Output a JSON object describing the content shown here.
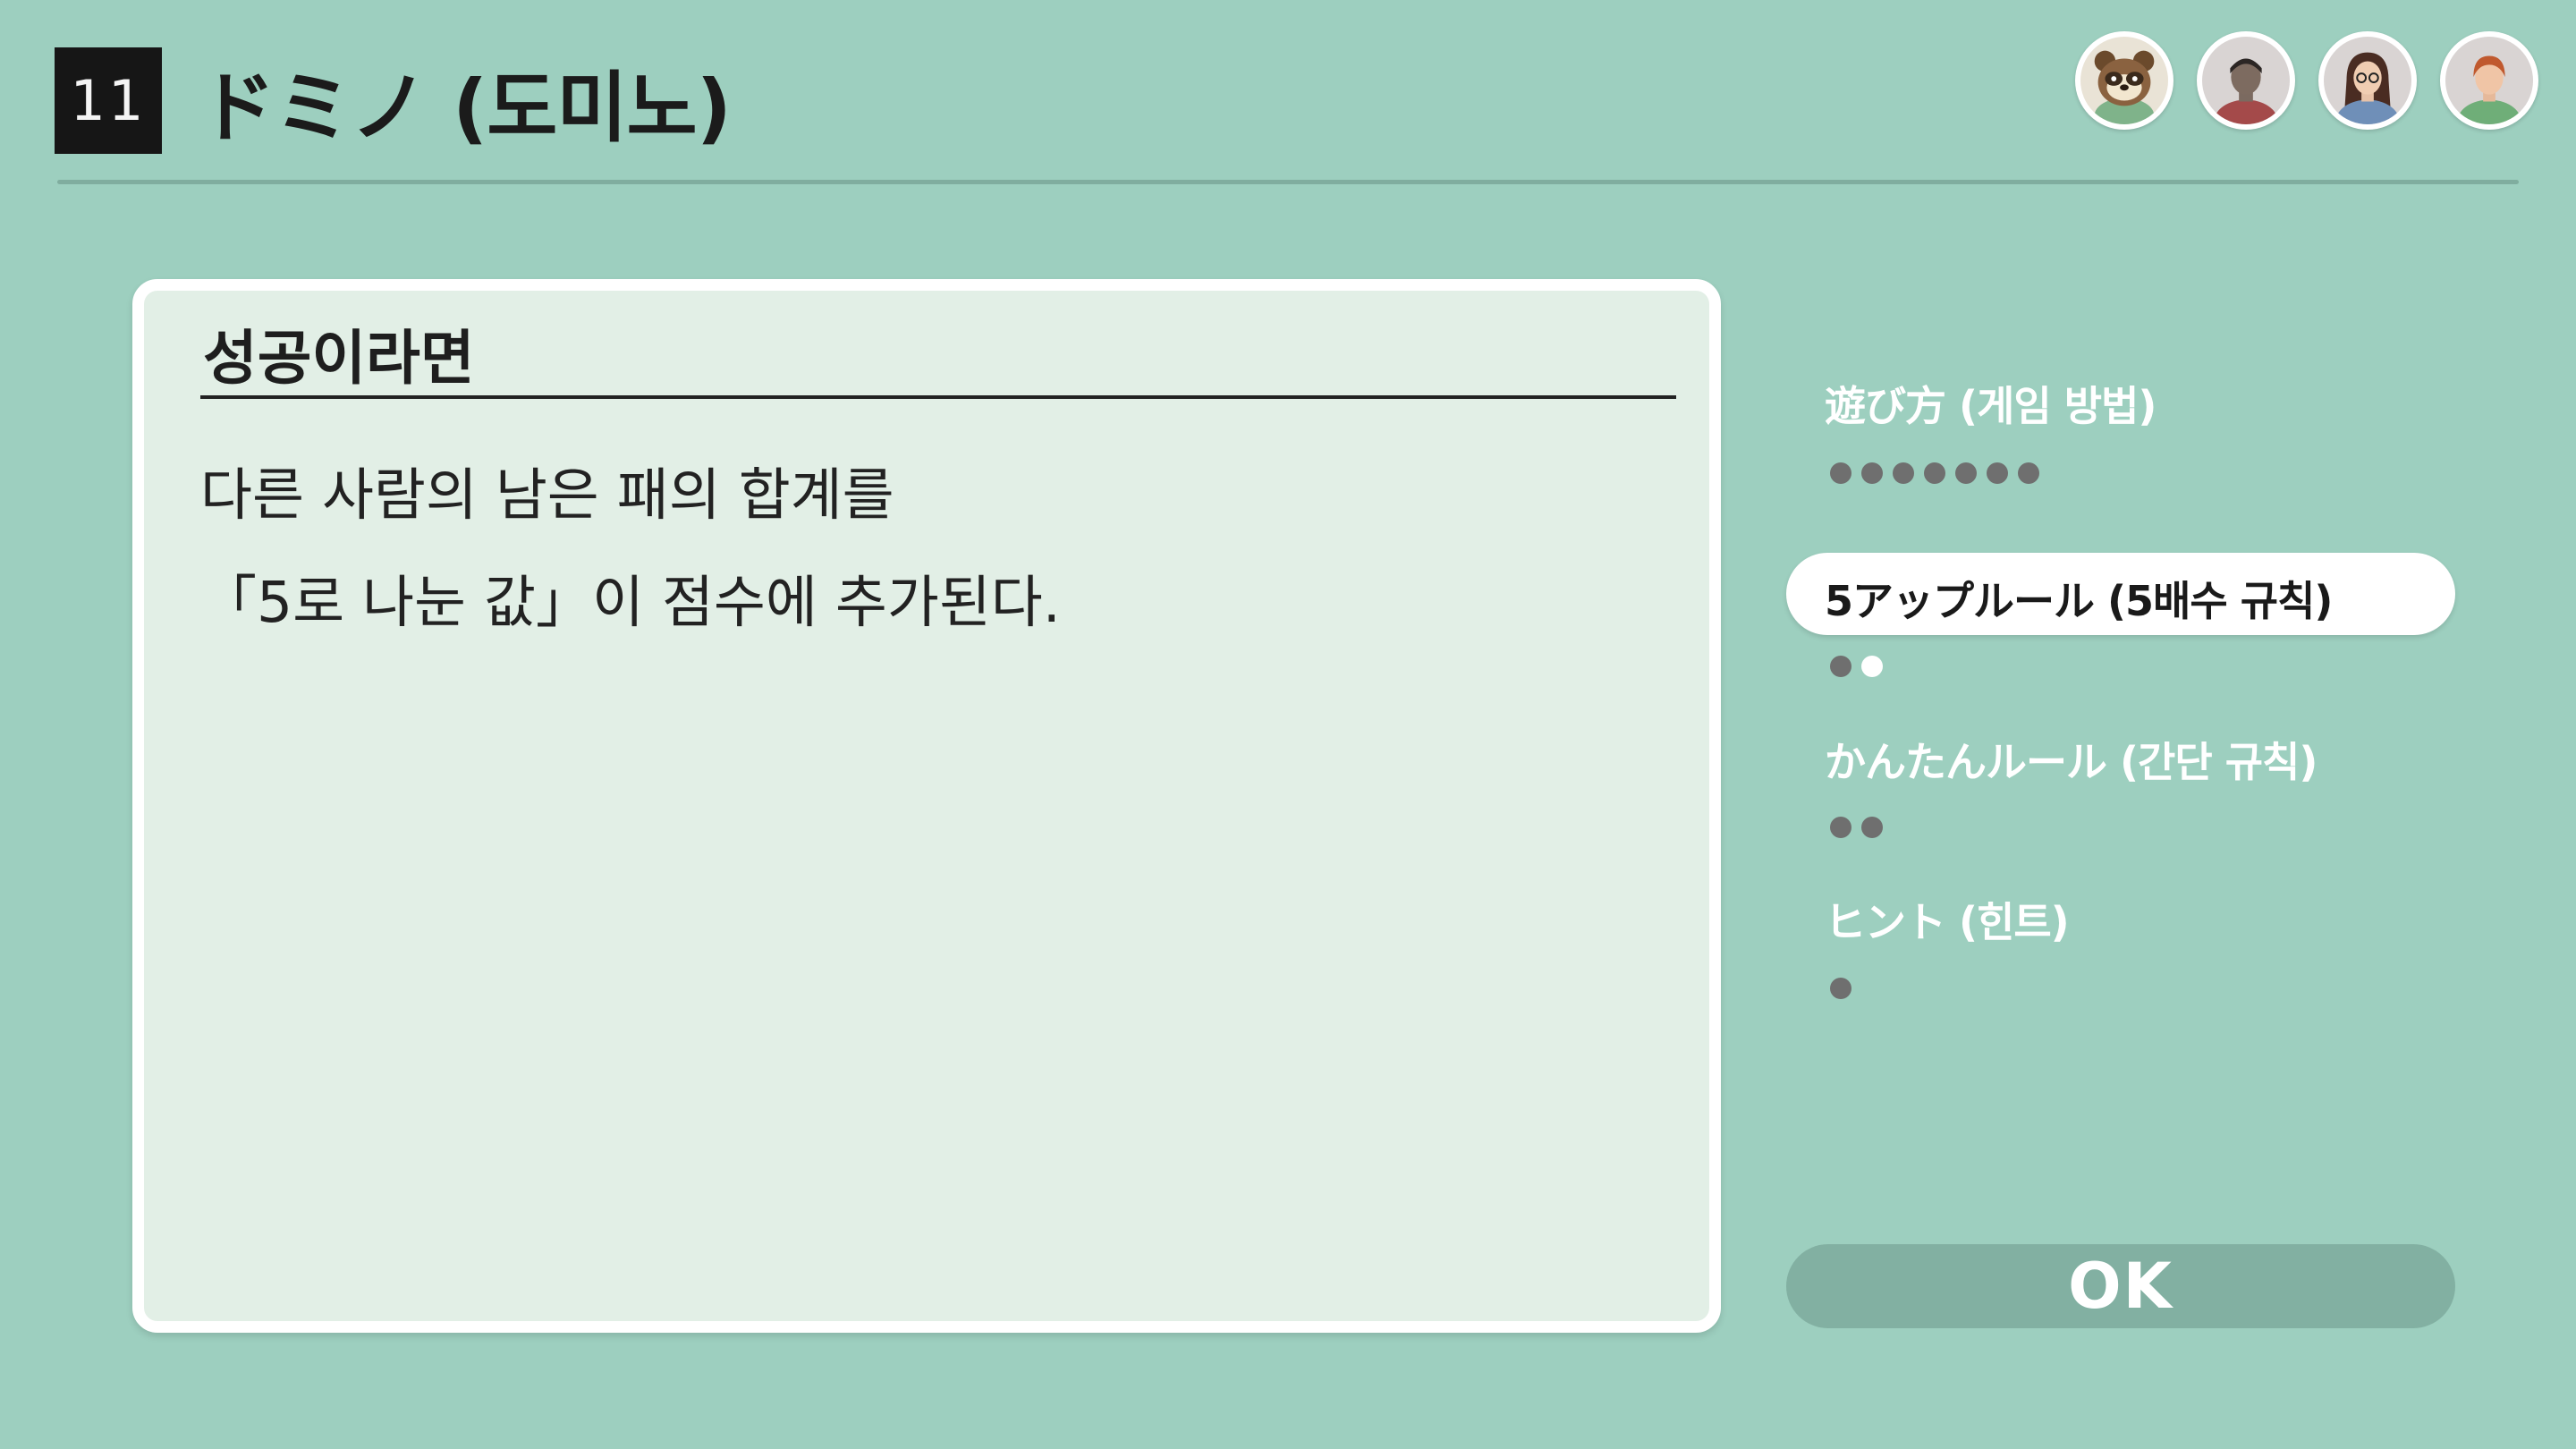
{
  "header": {
    "game_number": "11",
    "title": "ドミノ (도미노)"
  },
  "players": [
    {
      "icon": "raccoon-character-icon"
    },
    {
      "icon": "player-avatar-icon"
    },
    {
      "icon": "player-avatar-glasses-icon"
    },
    {
      "icon": "player-avatar-icon"
    }
  ],
  "card": {
    "heading": "성공이라면",
    "lines": [
      "다른 사람의 남은 패의 합계를",
      "「5로 나눈 값」이 점수에 추가된다."
    ]
  },
  "menu": {
    "items": [
      {
        "label": "遊び方 (게임 방법)",
        "pages": 7,
        "current_page": 0,
        "selected": false
      },
      {
        "label": "5アップルール (5배수 규칙)",
        "pages": 2,
        "current_page": 2,
        "selected": true
      },
      {
        "label": "かんたんルール (간단 규칙)",
        "pages": 2,
        "current_page": 0,
        "selected": false
      },
      {
        "label": "ヒント (힌트)",
        "pages": 1,
        "current_page": 0,
        "selected": false
      }
    ]
  },
  "ok_button": {
    "label": "OK"
  },
  "colors": {
    "background": "#9dcfbf",
    "card": "#e2efe6",
    "ok_button": "#82b0a2",
    "dot_inactive": "#6f6f6f",
    "dot_active": "#ffffff"
  }
}
